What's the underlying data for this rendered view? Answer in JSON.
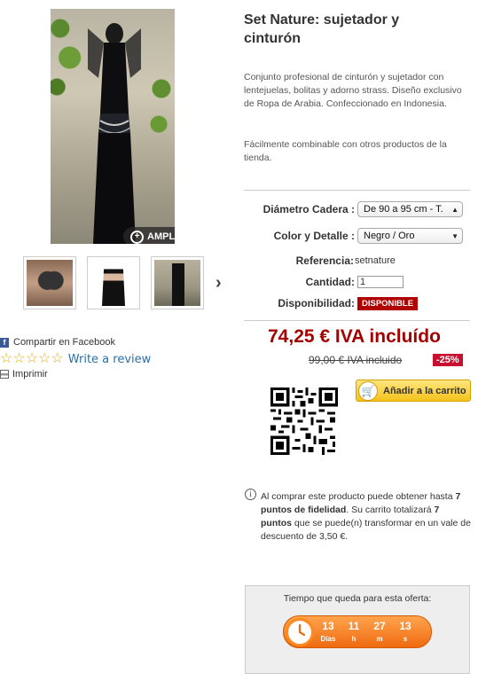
{
  "gallery": {
    "zoom_label": "AMPLIAR"
  },
  "share": {
    "facebook_label": "Compartir en Facebook",
    "review_label": "Write a review",
    "print_label": "Imprimir"
  },
  "product": {
    "title": "Set Nature: sujetador y cinturón",
    "description": "Conjunto profesional de cinturón y sujetador con lentejuelas, bolitas y adorno strass. Diseño exclusivo de Ropa de Arabia. Confeccionado en Indonesia.",
    "description2": "Fácilmente combinable con otros productos de la tienda.",
    "hip_label": "Diámetro Cadera :",
    "hip_value": "De 90 a 95 cm - T.",
    "color_label": "Color y Detalle :",
    "color_value": "Negro / Oro",
    "ref_label": "Referencia:",
    "ref_value": "setnature",
    "qty_label": "Cantidad:",
    "qty_value": "1",
    "avail_label": "Disponibilidad:",
    "avail_value": "DISPONIBLE",
    "price": "74,25 € IVA incluído",
    "old_price": "99,00 € IVA incluido",
    "discount": "-25%",
    "cart_label": "Añadir a la carrito"
  },
  "loyalty": {
    "part1": "Al comprar este producto puede obtener hasta ",
    "points": "7 puntos de fidelidad",
    "part2": ". Su carrito totalizará ",
    "total": "7 puntos",
    "part3": " que se puede(n) transformar en un vale de descuento de 3,50 €."
  },
  "timer": {
    "title": "Tiempo que queda para esta oferta:",
    "days": "13",
    "days_label": "Días",
    "hours": "11",
    "hours_label": "h",
    "minutes": "27",
    "minutes_label": "m",
    "seconds": "13",
    "seconds_label": "s"
  },
  "colors": {
    "price": "#a50000",
    "badge": "#b10000",
    "link": "#2a6fa8",
    "timer": "#f06a10"
  }
}
